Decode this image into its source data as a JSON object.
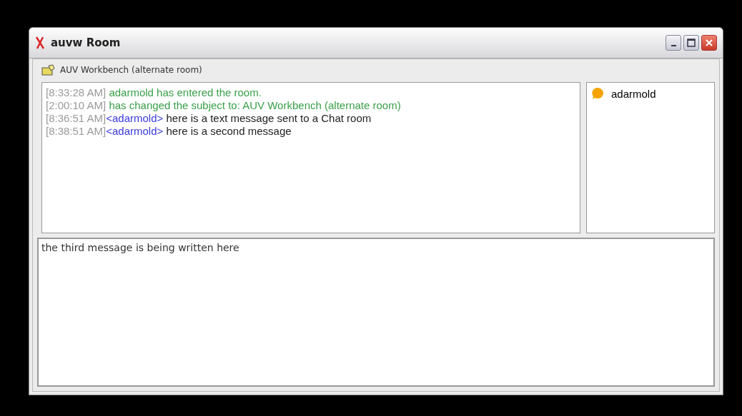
{
  "window": {
    "title": "auvw Room"
  },
  "subject": "AUV Workbench (alternate room)",
  "messages": [
    {
      "kind": "system",
      "time": "[8:33:28 AM]",
      "text": "adarmold has entered the room."
    },
    {
      "kind": "system",
      "time": "[2:00:10 AM]",
      "text": "has changed the subject to: AUV Workbench (alternate room)"
    },
    {
      "kind": "chat",
      "time": "[8:36:51 AM]",
      "nick": "<adarmold>",
      "text": "here is a text message sent to a Chat room"
    },
    {
      "kind": "chat",
      "time": "[8:38:51 AM]",
      "nick": "<adarmold>",
      "text": "here is a second message"
    }
  ],
  "users": [
    {
      "name": "adarmold"
    }
  ],
  "compose": {
    "value": "the third message is being written here"
  }
}
